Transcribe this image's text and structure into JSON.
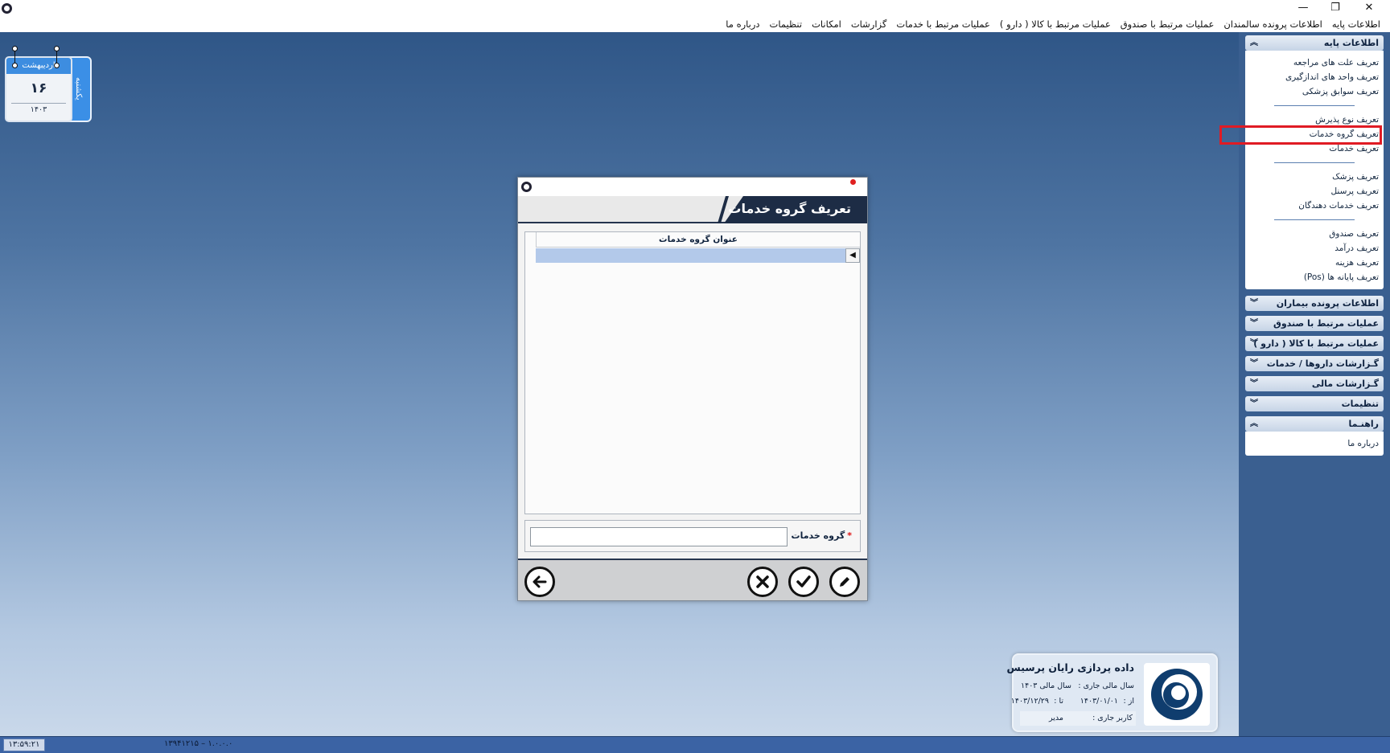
{
  "window": {
    "minimize": "—",
    "restore": "❐",
    "close": "✕"
  },
  "menubar": [
    "اطلاعات پایه",
    "اطلاعات پرونده سالمندان",
    "عملیات مرتبط با صندوق",
    "عملیات مرتبط با کالا ( دارو )",
    "عملیات مرتبط با خدمات",
    "گزارشات",
    "امکانات",
    "تنظیمات",
    "درباره ما"
  ],
  "calendar": {
    "month": "اردیبهشت",
    "day": "۱۶",
    "year": "۱۴۰۳",
    "weekday": "یکشنبه"
  },
  "sidebar": {
    "base_info": {
      "title": "اطلاعات پایه",
      "items": [
        "تعریف علت های مراجعه",
        "تعریف واحد های اندازگیری",
        "تعریف سوابق پزشکی",
        "تعریف نوع پذیرش",
        "تعریف گروه خدمات",
        "تعریف خدمات",
        "تعریف پزشک",
        "تعریف پرسنل",
        "تعریف خدمات دهندگان",
        "تعریف صندوق",
        "تعریف درآمد",
        "تعریف هزینه",
        "تعریف پایانه ها (Pos)"
      ]
    },
    "collapsed_groups": [
      "اطلاعات پرونده بیماران",
      "عملیات مرتبط با صندوق",
      "عملیات مرتبط با کالا ( دارو )",
      "گـزارشات داروها / خدمات",
      "گـزارشات مالی",
      "تنظیمات"
    ],
    "help": {
      "title": "راهنـما",
      "items": [
        "درباره ما"
      ]
    }
  },
  "dialog": {
    "title": "تعریف گروه خدمات",
    "grid_header": "عنوان گروه خدمات",
    "field_label": "گروه خدمات :",
    "field_required_mark": "*",
    "field_value": "",
    "row_indicator": "◀"
  },
  "company": {
    "name": "داده پردازی رایان پرسیس",
    "fiscal_year_label": "سال مالی جاری :",
    "fiscal_year_value": "سال مالی ۱۴۰۳",
    "from_label": "از :",
    "from_value": "۱۴۰۳/۰۱/۰۱",
    "to_label": "تا :",
    "to_value": "۱۴۰۳/۱۲/۲۹",
    "user_label": "کاربر جاری :",
    "user_value": "مدیر"
  },
  "statusbar": {
    "time": "۱۳:۵۹:۲۱",
    "version": "۱۳۹۴۱۲۱۵ – ۱.۰.۰.۰"
  },
  "colors": {
    "accent": "#1d2c45",
    "desktop_top": "#2f5687",
    "highlight": "#e01b24",
    "selected_row": "#b3c9ea"
  }
}
